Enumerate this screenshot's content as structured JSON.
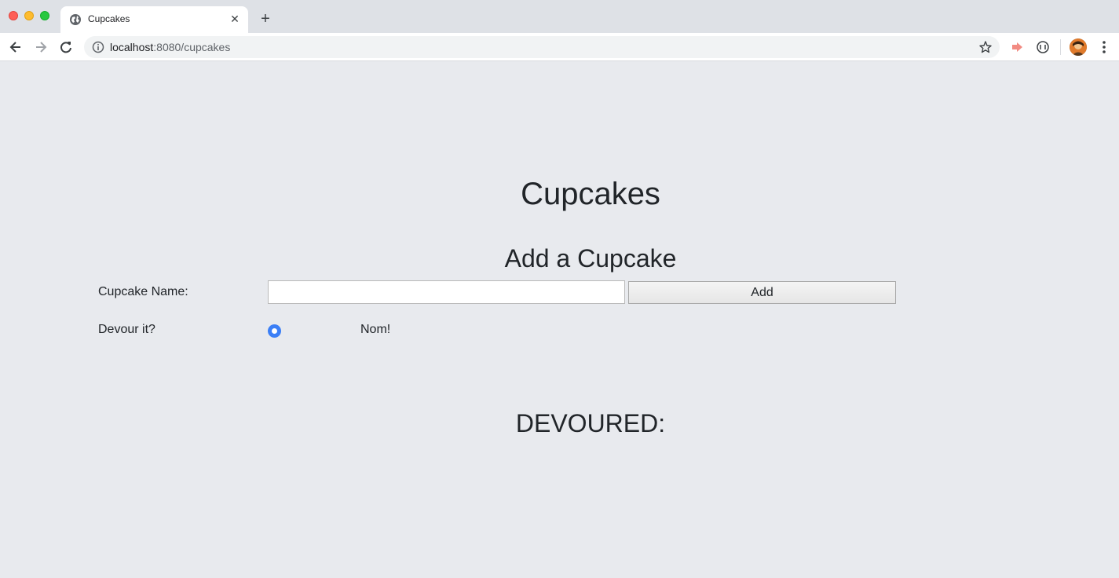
{
  "browser": {
    "tab_title": "Cupcakes",
    "tab_close": "✕",
    "new_tab": "+",
    "url_host": "localhost",
    "url_rest": ":8080/cupcakes"
  },
  "page": {
    "title": "Cupcakes",
    "form_heading": "Add a Cupcake",
    "name_label": "Cupcake Name:",
    "name_value": "",
    "add_button": "Add",
    "devour_label": "Devour it?",
    "radio_label": "Nom!",
    "radio_checked": true,
    "devoured_heading": "DEVOURED:"
  },
  "colors": {
    "page_background": "#e8eaee",
    "radio_accent": "#3b7ff6"
  }
}
